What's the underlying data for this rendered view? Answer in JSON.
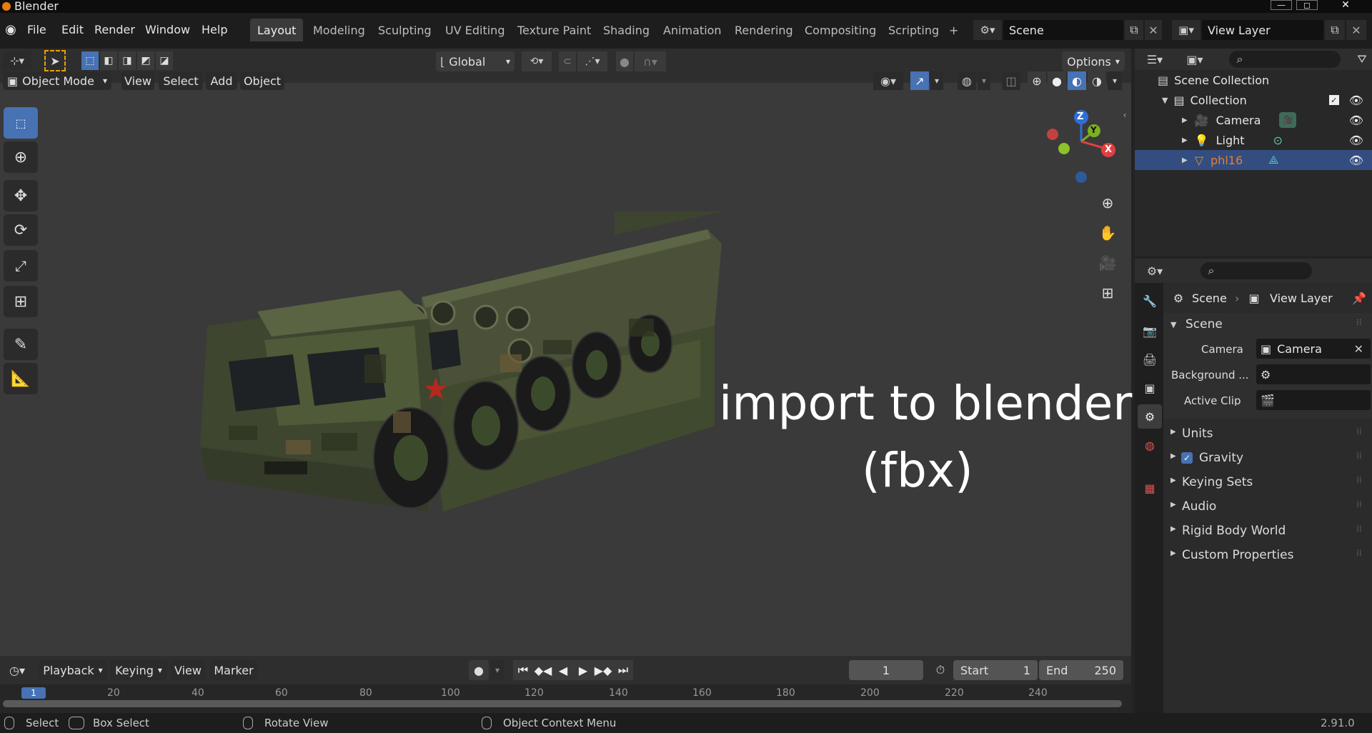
{
  "window": {
    "title": "Blender"
  },
  "menu": [
    "File",
    "Edit",
    "Render",
    "Window",
    "Help"
  ],
  "workspaces": [
    {
      "label": "Layout",
      "active": true
    },
    {
      "label": "Modeling"
    },
    {
      "label": "Sculpting"
    },
    {
      "label": "UV Editing"
    },
    {
      "label": "Texture Paint"
    },
    {
      "label": "Shading"
    },
    {
      "label": "Animation"
    },
    {
      "label": "Rendering"
    },
    {
      "label": "Compositing"
    },
    {
      "label": "Scripting"
    }
  ],
  "add_workspace": "+",
  "scene_field": "Scene",
  "view_layer_field": "View Layer",
  "toolbar": {
    "orientation": "Global",
    "options": "Options"
  },
  "viewport_header": {
    "mode": "Object Mode",
    "view": "View",
    "select": "Select",
    "add": "Add",
    "object": "Object"
  },
  "gizmo": {
    "z": "Z",
    "y": "Y",
    "x": "X"
  },
  "overlay_text": {
    "line1": "import to blender",
    "line2": "(fbx)"
  },
  "outliner": {
    "root": "Scene Collection",
    "collection": "Collection",
    "items": [
      {
        "label": "Camera",
        "selected": false
      },
      {
        "label": "Light",
        "selected": false
      },
      {
        "label": "phl16",
        "selected": true
      }
    ]
  },
  "properties": {
    "breadcrumb": {
      "scene": "Scene",
      "view_layer": "View Layer"
    },
    "section": "Scene",
    "camera_label": "Camera",
    "camera_value": "Camera",
    "background_label": "Background ...",
    "active_clip_label": "Active Clip",
    "subpanels": [
      "Units",
      "Gravity",
      "Keying Sets",
      "Audio",
      "Rigid Body World",
      "Custom Properties"
    ],
    "gravity_checked": true
  },
  "timeline": {
    "playback": "Playback",
    "keying": "Keying",
    "view": "View",
    "marker": "Marker",
    "current_frame": "1",
    "start_label": "Start",
    "start_value": "1",
    "end_label": "End",
    "end_value": "250",
    "ruler": [
      "1",
      "20",
      "40",
      "60",
      "80",
      "100",
      "120",
      "140",
      "160",
      "180",
      "200",
      "220",
      "240"
    ]
  },
  "status": {
    "select": "Select",
    "box_select": "Box Select",
    "rotate_view": "Rotate View",
    "context_menu": "Object Context Menu",
    "version": "2.91.0"
  },
  "colors": {
    "accent": "#4772b3",
    "selected_text": "#e57f33",
    "viewport_bg": "#3a3a3a"
  }
}
